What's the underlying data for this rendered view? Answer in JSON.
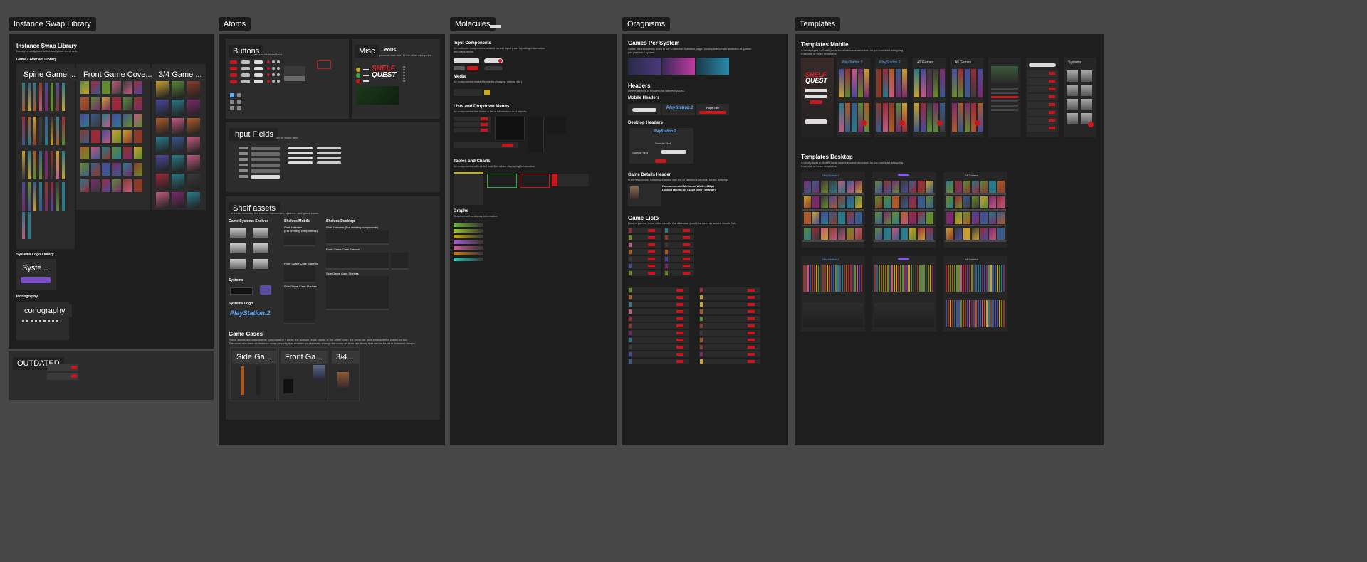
{
  "frames": {
    "instance_swap": {
      "label": "Instance Swap Library",
      "title": "Instance Swap Library",
      "subtitle": "Library of swappable icons and game cover arts.",
      "cover_art_heading": "Game Cover Art Library",
      "spine_label": "Spine Game ...",
      "front_label": "Front Game Cove...",
      "three_quarter_label": "3/4 Game ...",
      "systems_logo_heading": "Systems Logo Library",
      "systems_chip": "Syste...",
      "iconography_heading": "Iconography",
      "iconography_chip": "Iconography",
      "outdated_label": "OUTDATED"
    },
    "atoms": {
      "label": "Atoms",
      "buttons_chip": "Buttons",
      "buttons_sub": "...ask can be found here.",
      "misc_chip": "Misc",
      "misc_title_tail": "...eous",
      "misc_sub": "...ponents that don't fit the other categories.",
      "brand_logo_line1": "SHELF",
      "brand_logo_line2": "QUEST",
      "input_chip": "Input Fields",
      "input_sub": "...an be found here.",
      "shelf_chip": "Shelf assets",
      "shelf_sub": "...shelves, including the shelves themselves, systems, and game cases.",
      "game_systems_shelves": "Game Systems Shelves",
      "shelves_mobile": "Shelves Mobile",
      "shelves_desktop": "Shelves Desktop",
      "shelf_headers": "Shelf Headers",
      "for_creating": "(For creating components)",
      "shelf_headers_for_creating": "Shelf Headers (For creating components)",
      "front_game_case_shelves": "Front Game Case Shelves",
      "side_game_case_shelves": "Side Game Case Shelves",
      "systems": "Systems",
      "systems_logo": "Systems Logo",
      "playstation_logo": "PlayStation.2",
      "game_cases": "Game Cases",
      "game_cases_sub1": "These assets are components composed of 3 parts: the opaque black plastic of the game case, the cover art, and a transparent plastic on top.",
      "game_cases_sub2": "The cover arts have an instance swap property that enables you to easily change the cover art from our library that can be found in 'Instance Swaps.'",
      "side_chip": "Side Ga...",
      "front_chip": "Front Ga...",
      "three_quarter_chip": "3/4..."
    },
    "molecules": {
      "label": "Molecules",
      "input_components": "Input Components",
      "input_components_sub1": "All molecule components related to user input (user inputting information",
      "input_components_sub2": "into the system).",
      "media": "Media",
      "media_sub": "All components related to media (images, videos, etc.)",
      "lists": "Lists and Dropdown Menus",
      "lists_sub": "All components that forms a list of information and objects.",
      "tables": "Tables and Charts",
      "tables_sub": "All components with cells / look like tables displaying information.",
      "graphs": "Graphs",
      "graphs_sub": "Graphs used to display information"
    },
    "organisms": {
      "label": "Oragnisms",
      "games_per_system": "Games Per System",
      "games_per_system_sub1": "So far, it's exclusively used in the Collection Statistics page. It complete certain statistics of games",
      "games_per_system_sub2": "per platform / system.",
      "headers": "Headers",
      "headers_sub": "Different kinds of headers for different pages.",
      "mobile_headers": "Mobile Headers",
      "page_title": "Page Title",
      "desktop_headers": "Desktop Headers",
      "sample_text": "Sample Text",
      "game_details_header": "Game Details Header",
      "game_details_sub": "Fully responsive, meaning it works well for all platforms (mobile, tablet, desktop)",
      "rec_min_width": "Recommended Minimum Width: 412px",
      "locked_height": "Locked Height: of 318px (don't change)",
      "game_lists": "Game Lists",
      "game_lists_sub": "Lists of games, more often used in the database (could be used as search results list)."
    },
    "templates": {
      "label": "Templates",
      "templates_mobile": "Templates Mobile",
      "templates_mobile_sub1": "A lot of pages in Shelf Quest have the same structure, so you can start designing",
      "templates_mobile_sub2": "from one of these templates.",
      "templates_desktop": "Templates Desktop",
      "templates_desktop_sub1": "A lot of pages in Shelf Quest have the same structure, so you can start designing",
      "templates_desktop_sub2": "from one of these templates.",
      "playstation": "PlayStation.2",
      "all_games": "All Games",
      "systems": "Systems"
    }
  },
  "colors": {
    "canvas": "#474747",
    "frame": "#1e1e1e",
    "section": "#2c2c2c",
    "accent_red": "#c8161d"
  }
}
